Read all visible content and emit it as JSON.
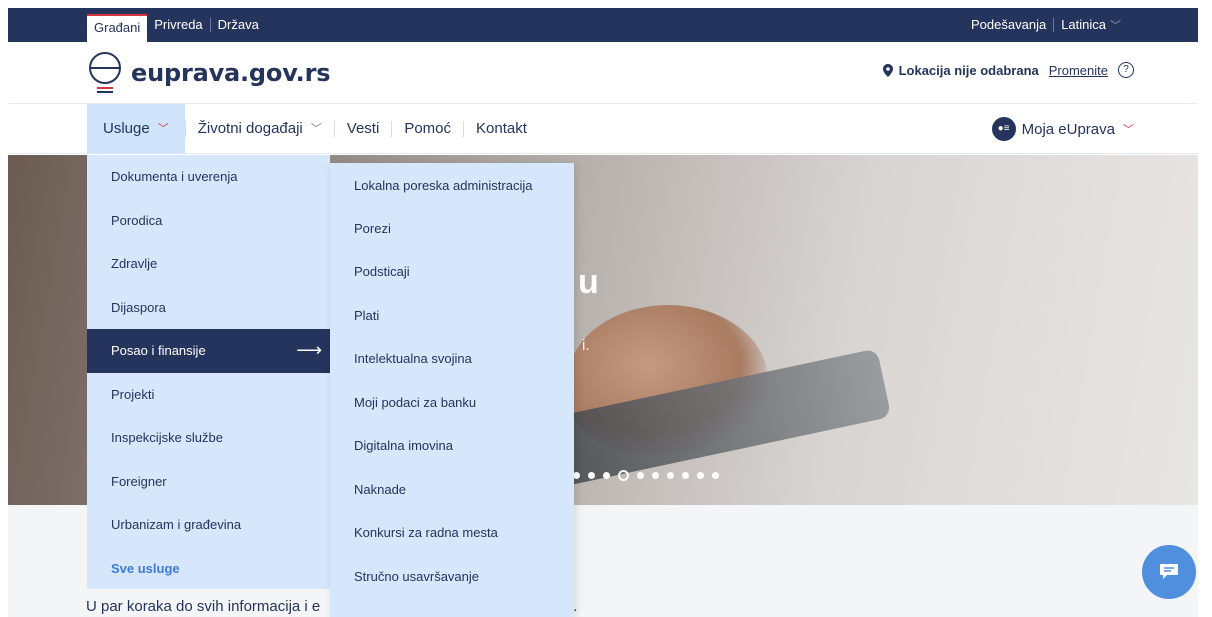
{
  "topbar": {
    "tabs": [
      {
        "label": "Građani",
        "active": true
      },
      {
        "label": "Privreda"
      },
      {
        "label": "Država"
      }
    ],
    "settings": "Podešavanja",
    "script": "Latinica"
  },
  "header": {
    "logo_text": "euprava.gov.rs",
    "location_status": "Lokacija nije odabrana",
    "location_change": "Promenite",
    "help": "?"
  },
  "nav": {
    "items": [
      "Usluge",
      "Životni događaji",
      "Vesti",
      "Pomoć",
      "Kontakt"
    ],
    "account": "Moja eUprava"
  },
  "menu": {
    "categories": [
      "Dokumenta i uverenja",
      "Porodica",
      "Zdravlje",
      "Dijaspora",
      "Posao i finansije",
      "Projekti",
      "Inspekcijske službe",
      "Foreigner",
      "Urbanizam i građevina"
    ],
    "all_services": "Sve usluge",
    "subitems": [
      "Lokalna poreska administracija",
      "Porezi",
      "Podsticaji",
      "Plati",
      "Intelektualna svojina",
      "Moji podaci za banku",
      "Digitalna imovina",
      "Naknade",
      "Konkursi za radna mesta",
      "Stručno usavršavanje"
    ]
  },
  "hero": {
    "title_fragment": "u",
    "text_fragment": "i.",
    "slide_count": 10,
    "active_slide": 3
  },
  "tagline": {
    "left": "U par koraka do svih informacija i e",
    "right": "iji."
  },
  "colors": {
    "navy": "#24345c",
    "accent_red": "#d8343e",
    "menu_bg": "#d6e6fb",
    "link_blue": "#3d7bd6",
    "chat_blue": "#4f8fdd"
  }
}
